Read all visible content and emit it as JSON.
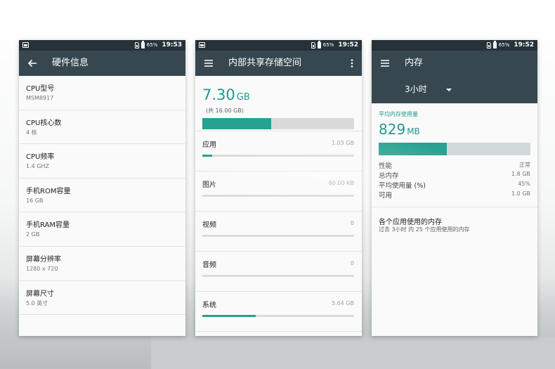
{
  "status": {
    "battery_pct": "65%",
    "times": [
      "19:53",
      "19:52",
      "19:52"
    ]
  },
  "hardware": {
    "title": "硬件信息",
    "items": [
      {
        "label": "CPU型号",
        "value": "MSM8917"
      },
      {
        "label": "CPU核心数",
        "value": "4 核"
      },
      {
        "label": "CPU频率",
        "value": "1.4 GHZ"
      },
      {
        "label": "手机ROM容量",
        "value": "16 GB"
      },
      {
        "label": "手机RAM容量",
        "value": "2 GB"
      },
      {
        "label": "屏幕分辨率",
        "value": "1280 x 720"
      },
      {
        "label": "屏幕尺寸",
        "value": "5.0 英寸"
      }
    ]
  },
  "storage": {
    "title": "内部共享存储空间",
    "used_value": "7.30",
    "used_unit": "GB",
    "total_text": "(共 16.00 GB)",
    "used_fraction": 0.456,
    "categories": [
      {
        "name": "应用",
        "size": "1.03 GB",
        "fraction": 0.064
      },
      {
        "name": "图片",
        "size": "60.00 KB",
        "fraction": 0.0
      },
      {
        "name": "视频",
        "size": "0",
        "fraction": 0.0
      },
      {
        "name": "音频",
        "size": "0",
        "fraction": 0.0
      },
      {
        "name": "系统",
        "size": "5.64 GB",
        "fraction": 0.352
      }
    ]
  },
  "memory": {
    "title": "内存",
    "period": "3小时",
    "avg_label": "平均内存使用量",
    "avg_value": "829",
    "avg_unit": "MB",
    "used_fraction": 0.45,
    "stats": [
      {
        "key": "性能",
        "value": "正常"
      },
      {
        "key": "总内存",
        "value": "1.8 GB"
      },
      {
        "key": "平均使用量 (%)",
        "value": "45%"
      },
      {
        "key": "可用",
        "value": "1.0 GB"
      }
    ],
    "apps_title": "各个应用使用的内存",
    "apps_subtitle": "过去 3小时 内 25 个应用使用的内存"
  },
  "colors": {
    "accent": "#27a191",
    "toolbar": "#37474f",
    "statusbar": "#263238"
  },
  "icons": {
    "back": "arrow-left-icon",
    "menu": "hamburger-menu-icon",
    "more": "more-vert-icon",
    "dropdown": "dropdown-arrow-icon"
  }
}
